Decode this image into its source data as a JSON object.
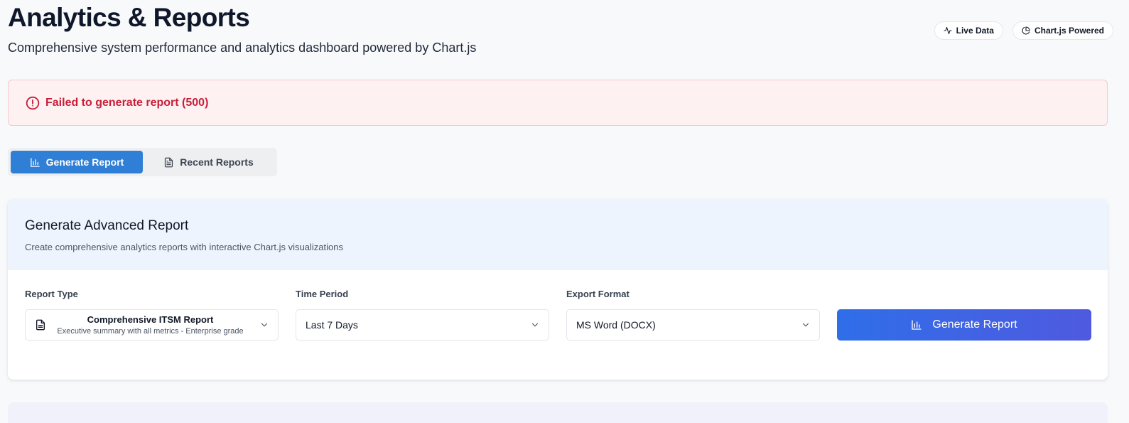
{
  "header": {
    "title": "Analytics & Reports",
    "subtitle": "Comprehensive system performance and analytics dashboard powered by Chart.js"
  },
  "badges": [
    {
      "label": "Live Data",
      "icon": "activity-icon"
    },
    {
      "label": "Chart.js Powered",
      "icon": "pie-chart-icon"
    }
  ],
  "alert": {
    "message": "Failed to generate report (500)",
    "icon": "alert-circle-icon",
    "color": "#c81e3a"
  },
  "tabs": [
    {
      "label": "Generate Report",
      "icon": "bar-chart-icon",
      "active": true
    },
    {
      "label": "Recent Reports",
      "icon": "file-text-icon",
      "active": false
    }
  ],
  "panel": {
    "title": "Generate Advanced Report",
    "description": "Create comprehensive analytics reports with interactive Chart.js visualizations",
    "fields": {
      "report_type": {
        "label": "Report Type",
        "value": "Comprehensive ITSM Report",
        "description": "Executive summary with all metrics - Enterprise grade"
      },
      "time_period": {
        "label": "Time Period",
        "value": "Last 7 Days"
      },
      "export_format": {
        "label": "Export Format",
        "value": "MS Word (DOCX)"
      }
    },
    "generate_button": "Generate Report"
  },
  "colors": {
    "accent": "#2f7fd6",
    "button_gradient_start": "#2f6ee8",
    "button_gradient_end": "#4f5ae0",
    "alert_background": "#fdf1f1"
  }
}
